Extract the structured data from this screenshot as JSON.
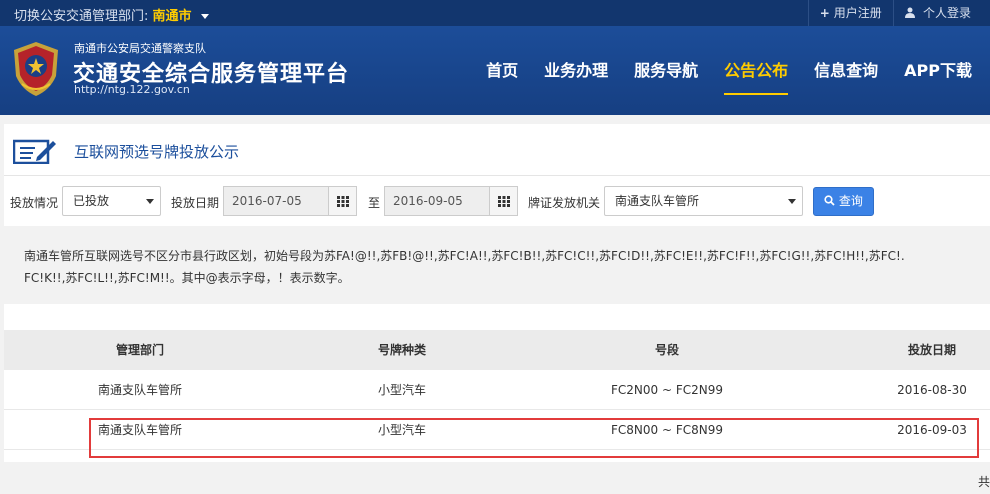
{
  "topbar": {
    "switch_label": "切换公安交通管理部门:",
    "city": "南通市",
    "register": "用户注册",
    "login": "个人登录"
  },
  "header": {
    "org": "南通市公安局交通警察支队",
    "title": "交通安全综合服务管理平台",
    "url": "http://ntg.122.gov.cn"
  },
  "nav": {
    "items": [
      {
        "label": "首页"
      },
      {
        "label": "业务办理"
      },
      {
        "label": "服务导航"
      },
      {
        "label": "公告公布"
      },
      {
        "label": "信息查询"
      },
      {
        "label": "APP下载"
      }
    ]
  },
  "section": {
    "title": "互联网预选号牌投放公示"
  },
  "filters": {
    "status_label": "投放情况",
    "status_value": "已投放",
    "date_label": "投放日期",
    "date_from": "2016-07-05",
    "to_label": "至",
    "date_to": "2016-09-05",
    "authority_label": "牌证发放机关",
    "authority_value": "南通支队车管所",
    "search_button": "查询"
  },
  "notice": {
    "line1": "南通车管所互联网选号不区分市县行政区划，初始号段为苏FA!@!!,苏FB!@!!,苏FC!A!!,苏FC!B!!,苏FC!C!!,苏FC!D!!,苏FC!E!!,苏FC!F!!,苏FC!G!!,苏FC!H!!,苏FC!.",
    "line2": "FC!K!!,苏FC!L!!,苏FC!M!!。其中@表示字母，！表示数字。"
  },
  "table": {
    "headers": [
      "管理部门",
      "号牌种类",
      "号段",
      "投放日期"
    ],
    "rows": [
      [
        "南通支队车管所",
        "小型汽车",
        "FC2N00 ~ FC2N99",
        "2016-08-30"
      ],
      [
        "南通支队车管所",
        "小型汽车",
        "FC8N00 ~ FC8N99",
        "2016-09-03"
      ]
    ]
  },
  "pager": {
    "text": "共"
  },
  "colors": {
    "topbar": "#12366e",
    "header": "#1a4a94",
    "accent": "#ffcc00",
    "button": "#3b82e6",
    "highlight": "#e23b3b"
  }
}
